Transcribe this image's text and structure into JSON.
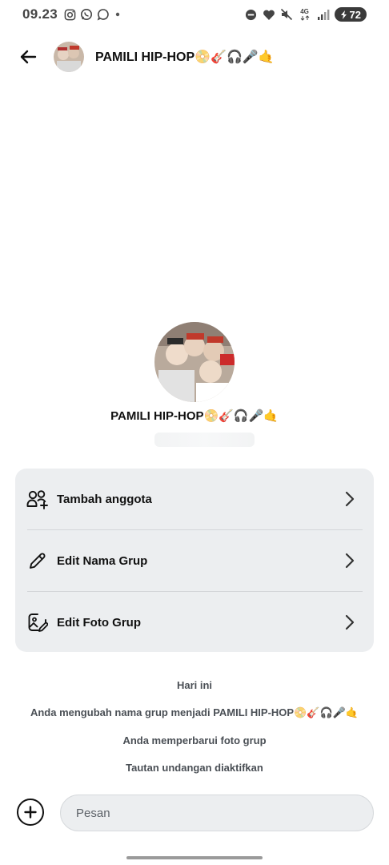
{
  "status_bar": {
    "time": "09.23",
    "left_icons": [
      "instagram-icon",
      "whatsapp-icon",
      "chat-bubble-icon",
      "dot-icon"
    ],
    "right_icons": [
      "dnd-icon",
      "heart-icon",
      "mute-icon",
      "network-4g-icon",
      "signal-icon"
    ],
    "network_label": "4G",
    "battery_level": "72"
  },
  "header": {
    "title": "PAMILI HIP-HOP",
    "title_emojis": "📀🎸🎧🎤🤙"
  },
  "group": {
    "name": "PAMILI HIP-HOP",
    "name_emojis": "📀🎸🎧🎤🤙"
  },
  "actions": [
    {
      "label": "Tambah anggota",
      "icon": "add-member-icon"
    },
    {
      "label": "Edit Nama Grup",
      "icon": "pencil-icon"
    },
    {
      "label": "Edit Foto Grup",
      "icon": "edit-photo-icon"
    }
  ],
  "system_messages": {
    "date": "Hari ini",
    "rename_text": "Anda mengubah nama grup menjadi PAMILI HIP-HOP",
    "rename_emojis": "📀🎸🎧🎤🤙",
    "photo_update": "Anda memperbarui foto grup",
    "invite_link": "Tautan undangan diaktifkan"
  },
  "composer": {
    "placeholder": "Pesan"
  },
  "colors": {
    "card_bg": "#eceef0",
    "text_primary": "#111111",
    "text_secondary": "#4a4f55"
  }
}
